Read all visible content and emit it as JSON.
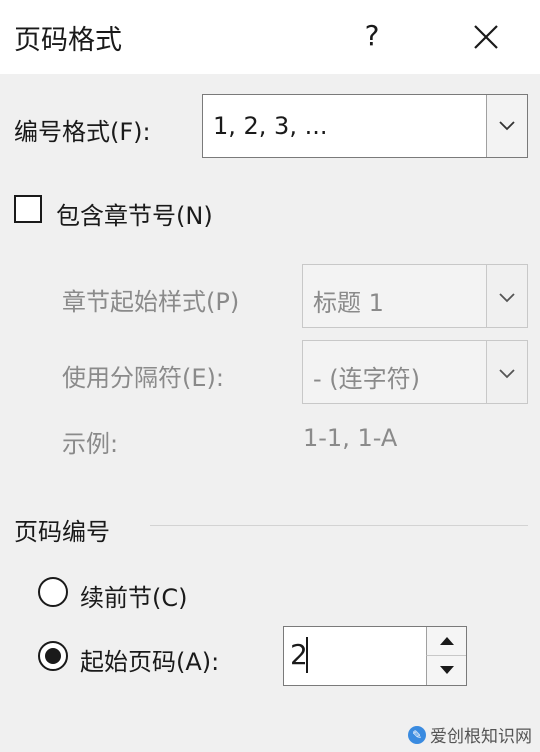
{
  "dialog": {
    "title": "页码格式",
    "help_label": "?",
    "close_icon": "close-icon"
  },
  "number_format": {
    "label": "编号格式(F):",
    "value": "1, 2, 3, ..."
  },
  "include_chapter": {
    "label": "包含章节号(N)",
    "checked": false
  },
  "chapter_style": {
    "label": "章节起始样式(P)",
    "value": "标题 1"
  },
  "separator": {
    "label": "使用分隔符(E):",
    "value": "-   (连字符)"
  },
  "example": {
    "label": "示例:",
    "value": "1-1, 1-A"
  },
  "page_numbering": {
    "section_label": "页码编号",
    "continue_label": "续前节(C)",
    "start_label": "起始页码(A):",
    "start_value": "2",
    "selected": "start"
  },
  "watermark": {
    "text": "爱创根知识网"
  },
  "colors": {
    "background": "#f0f0f0",
    "disabled_text": "#8a8a8a"
  }
}
